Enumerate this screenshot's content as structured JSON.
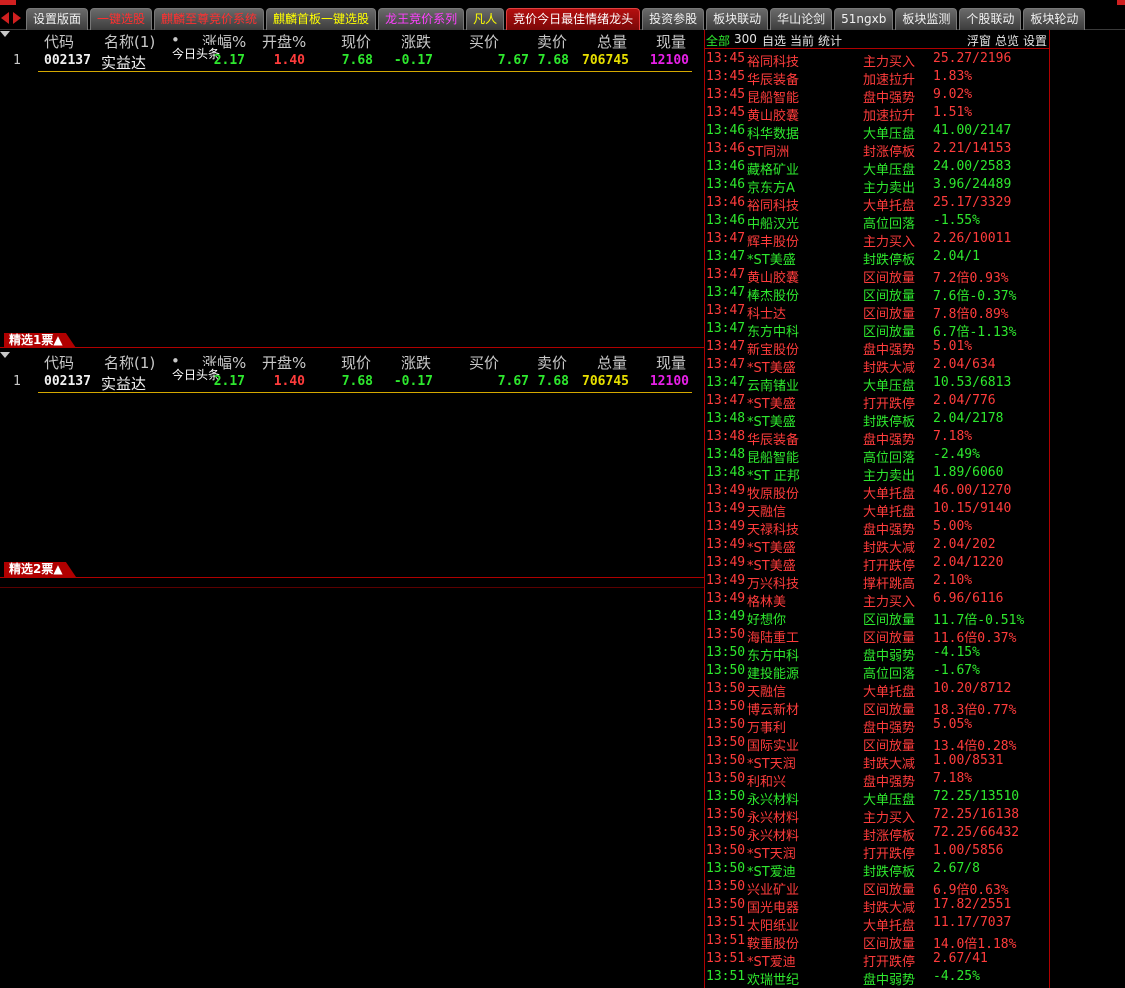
{
  "colors": {
    "red": "#ff3c3c",
    "green": "#2ee82e",
    "yellow": "#e8e000",
    "magenta": "#e820e8",
    "white": "#f2f2f2",
    "gray": "#c8c8c8",
    "accent": "#b00000"
  },
  "tabs": [
    {
      "label": "设置版面",
      "color": "#f0f0f0",
      "active": false
    },
    {
      "label": "一键选股",
      "color": "#ff3030",
      "active": false
    },
    {
      "label": "麒麟至尊竞价系统",
      "color": "#ff3030",
      "active": false
    },
    {
      "label": "麒麟首板一键选股",
      "color": "#ffff00",
      "active": false
    },
    {
      "label": "龙王竞价系列",
      "color": "#ff40ff",
      "active": false
    },
    {
      "label": "凡人",
      "color": "#ffff00",
      "active": false
    },
    {
      "label": "竞价今日最佳情绪龙头",
      "color": "#ffffff",
      "active": true
    },
    {
      "label": "投资参股",
      "color": "#f0f0f0",
      "active": false
    },
    {
      "label": "板块联动",
      "color": "#f0f0f0",
      "active": false
    },
    {
      "label": "华山论剑",
      "color": "#f0f0f0",
      "active": false
    },
    {
      "label": "51ngxb",
      "color": "#f0f0f0",
      "active": false
    },
    {
      "label": "板块监测",
      "color": "#f0f0f0",
      "active": false
    },
    {
      "label": "个股联动",
      "color": "#f0f0f0",
      "active": false
    },
    {
      "label": "板块轮动",
      "color": "#f0f0f0",
      "active": false
    }
  ],
  "columns": {
    "code": "代码",
    "name": "名称(1)",
    "dot": "•",
    "change_pct": "涨幅%",
    "open_pct": "开盘%",
    "price": "现价",
    "change": "涨跌",
    "bid": "买价",
    "ask": "卖价",
    "volume": "总量",
    "cur_vol": "现量"
  },
  "table1": {
    "rows": [
      {
        "index": "1",
        "code": "002137",
        "name": "实益达",
        "news": "今日头条",
        "change_pct": "2.17",
        "open_pct": "1.40",
        "price": "7.68",
        "change": "-0.17",
        "bid": "7.67",
        "ask": "7.68",
        "volume": "706745",
        "cur_vol": "12100"
      }
    ]
  },
  "section1": {
    "label": "精选1票▲"
  },
  "table2": {
    "rows": [
      {
        "index": "1",
        "code": "002137",
        "name": "实益达",
        "news": "今日头条",
        "change_pct": "2.17",
        "open_pct": "1.40",
        "price": "7.68",
        "change": "-0.17",
        "bid": "7.67",
        "ask": "7.68",
        "volume": "706745",
        "cur_vol": "12100"
      }
    ]
  },
  "section2": {
    "label": "精选2票▲"
  },
  "right_panel": {
    "filters": {
      "all": "全部",
      "n300": "300",
      "watchlist": "自选",
      "current": "当前",
      "stats": "统计",
      "float": "浮窗",
      "overview": "总览",
      "settings": "设置"
    },
    "alerts": [
      {
        "time": "13:45",
        "name": "裕同科技",
        "type": "主力买入",
        "value": "25.27/2196",
        "dir": "up"
      },
      {
        "time": "13:45",
        "name": "华辰装备",
        "type": "加速拉升",
        "value": "1.83%",
        "dir": "up"
      },
      {
        "time": "13:45",
        "name": "昆船智能",
        "type": "盘中强势",
        "value": "9.02%",
        "dir": "up"
      },
      {
        "time": "13:45",
        "name": "黄山胶囊",
        "type": "加速拉升",
        "value": "1.51%",
        "dir": "up"
      },
      {
        "time": "13:46",
        "name": "科华数据",
        "type": "大单压盘",
        "value": "41.00/2147",
        "dir": "down"
      },
      {
        "time": "13:46",
        "name": "ST同洲",
        "type": "封涨停板",
        "value": "2.21/14153",
        "dir": "up"
      },
      {
        "time": "13:46",
        "name": "藏格矿业",
        "type": "大单压盘",
        "value": "24.00/2583",
        "dir": "down"
      },
      {
        "time": "13:46",
        "name": "京东方A",
        "type": "主力卖出",
        "value": "3.96/24489",
        "dir": "down"
      },
      {
        "time": "13:46",
        "name": "裕同科技",
        "type": "大单托盘",
        "value": "25.17/3329",
        "dir": "up"
      },
      {
        "time": "13:46",
        "name": "中船汉光",
        "type": "高位回落",
        "value": "-1.55%",
        "dir": "down"
      },
      {
        "time": "13:47",
        "name": "辉丰股份",
        "type": "主力买入",
        "value": "2.26/10011",
        "dir": "up"
      },
      {
        "time": "13:47",
        "name": "*ST美盛",
        "type": "封跌停板",
        "value": "2.04/1",
        "dir": "down"
      },
      {
        "time": "13:47",
        "name": "黄山胶囊",
        "type": "区间放量",
        "value": "7.2倍0.93%",
        "dir": "up"
      },
      {
        "time": "13:47",
        "name": "棒杰股份",
        "type": "区间放量",
        "value": "7.6倍-0.37%",
        "dir": "down"
      },
      {
        "time": "13:47",
        "name": "科士达",
        "type": "区间放量",
        "value": "7.8倍0.89%",
        "dir": "up"
      },
      {
        "time": "13:47",
        "name": "东方中科",
        "type": "区间放量",
        "value": "6.7倍-1.13%",
        "dir": "down"
      },
      {
        "time": "13:47",
        "name": "新宝股份",
        "type": "盘中强势",
        "value": "5.01%",
        "dir": "up"
      },
      {
        "time": "13:47",
        "name": "*ST美盛",
        "type": "封跌大减",
        "value": "2.04/634",
        "dir": "up"
      },
      {
        "time": "13:47",
        "name": "云南锗业",
        "type": "大单压盘",
        "value": "10.53/6813",
        "dir": "down"
      },
      {
        "time": "13:47",
        "name": "*ST美盛",
        "type": "打开跌停",
        "value": "2.04/776",
        "dir": "up"
      },
      {
        "time": "13:48",
        "name": "*ST美盛",
        "type": "封跌停板",
        "value": "2.04/2178",
        "dir": "down"
      },
      {
        "time": "13:48",
        "name": "华辰装备",
        "type": "盘中强势",
        "value": "7.18%",
        "dir": "up"
      },
      {
        "time": "13:48",
        "name": "昆船智能",
        "type": "高位回落",
        "value": "-2.49%",
        "dir": "down"
      },
      {
        "time": "13:48",
        "name": "*ST 正邦",
        "type": "主力卖出",
        "value": "1.89/6060",
        "dir": "down"
      },
      {
        "time": "13:49",
        "name": "牧原股份",
        "type": "大单托盘",
        "value": "46.00/1270",
        "dir": "up"
      },
      {
        "time": "13:49",
        "name": "天融信",
        "type": "大单托盘",
        "value": "10.15/9140",
        "dir": "up"
      },
      {
        "time": "13:49",
        "name": "天禄科技",
        "type": "盘中强势",
        "value": "5.00%",
        "dir": "up"
      },
      {
        "time": "13:49",
        "name": "*ST美盛",
        "type": "封跌大减",
        "value": "2.04/202",
        "dir": "up"
      },
      {
        "time": "13:49",
        "name": "*ST美盛",
        "type": "打开跌停",
        "value": "2.04/1220",
        "dir": "up"
      },
      {
        "time": "13:49",
        "name": "万兴科技",
        "type": "撑杆跳高",
        "value": "2.10%",
        "dir": "up"
      },
      {
        "time": "13:49",
        "name": "格林美",
        "type": "主力买入",
        "value": "6.96/6116",
        "dir": "up"
      },
      {
        "time": "13:49",
        "name": "好想你",
        "type": "区间放量",
        "value": "11.7倍-0.51%",
        "dir": "down"
      },
      {
        "time": "13:50",
        "name": "海陆重工",
        "type": "区间放量",
        "value": "11.6倍0.37%",
        "dir": "up"
      },
      {
        "time": "13:50",
        "name": "东方中科",
        "type": "盘中弱势",
        "value": "-4.15%",
        "dir": "down"
      },
      {
        "time": "13:50",
        "name": "建投能源",
        "type": "高位回落",
        "value": "-1.67%",
        "dir": "down"
      },
      {
        "time": "13:50",
        "name": "天融信",
        "type": "大单托盘",
        "value": "10.20/8712",
        "dir": "up"
      },
      {
        "time": "13:50",
        "name": "博云新材",
        "type": "区间放量",
        "value": "18.3倍0.77%",
        "dir": "up"
      },
      {
        "time": "13:50",
        "name": "万事利",
        "type": "盘中强势",
        "value": "5.05%",
        "dir": "up"
      },
      {
        "time": "13:50",
        "name": "国际实业",
        "type": "区间放量",
        "value": "13.4倍0.28%",
        "dir": "up"
      },
      {
        "time": "13:50",
        "name": "*ST天润",
        "type": "封跌大减",
        "value": "1.00/8531",
        "dir": "up"
      },
      {
        "time": "13:50",
        "name": "利和兴",
        "type": "盘中强势",
        "value": "7.18%",
        "dir": "up"
      },
      {
        "time": "13:50",
        "name": "永兴材料",
        "type": "大单压盘",
        "value": "72.25/13510",
        "dir": "down"
      },
      {
        "time": "13:50",
        "name": "永兴材料",
        "type": "主力买入",
        "value": "72.25/16138",
        "dir": "up"
      },
      {
        "time": "13:50",
        "name": "永兴材料",
        "type": "封涨停板",
        "value": "72.25/66432",
        "dir": "up"
      },
      {
        "time": "13:50",
        "name": "*ST天润",
        "type": "打开跌停",
        "value": "1.00/5856",
        "dir": "up"
      },
      {
        "time": "13:50",
        "name": "*ST爱迪",
        "type": "封跌停板",
        "value": "2.67/8",
        "dir": "down"
      },
      {
        "time": "13:50",
        "name": "兴业矿业",
        "type": "区间放量",
        "value": "6.9倍0.63%",
        "dir": "up"
      },
      {
        "time": "13:50",
        "name": "国光电器",
        "type": "封跌大减",
        "value": "17.82/2551",
        "dir": "up"
      },
      {
        "time": "13:51",
        "name": "太阳纸业",
        "type": "大单托盘",
        "value": "11.17/7037",
        "dir": "up"
      },
      {
        "time": "13:51",
        "name": "鞍重股份",
        "type": "区间放量",
        "value": "14.0倍1.18%",
        "dir": "up"
      },
      {
        "time": "13:51",
        "name": "*ST爱迪",
        "type": "打开跌停",
        "value": "2.67/41",
        "dir": "up"
      },
      {
        "time": "13:51",
        "name": "欢瑞世纪",
        "type": "盘中弱势",
        "value": "-4.25%",
        "dir": "down"
      }
    ]
  }
}
